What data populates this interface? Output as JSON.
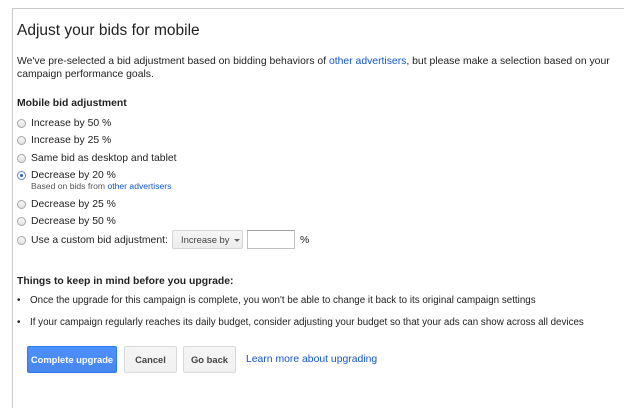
{
  "dialog": {
    "title": "Adjust your bids for mobile",
    "intro": {
      "before_link": "We've pre-selected a bid adjustment based on bidding behaviors of ",
      "link": "other advertisers",
      "after_link": ", but please make a selection based on your campaign performance goals."
    }
  },
  "bid_adjustment": {
    "heading": "Mobile bid adjustment",
    "selected_index": 3,
    "options": [
      {
        "label": "Increase by 50 %"
      },
      {
        "label": "Increase by 25 %"
      },
      {
        "label": "Same bid as desktop and tablet"
      },
      {
        "label": "Decrease by 20 %"
      },
      {
        "label": "Decrease by 25 %"
      },
      {
        "label": "Decrease by 50 %"
      },
      {
        "label": "Use a custom bid adjustment:"
      }
    ],
    "recommended_note": {
      "before_link": "Based on bids from ",
      "link": "other advertisers"
    },
    "custom": {
      "direction_selected": "Increase by",
      "value": "",
      "unit": "%"
    }
  },
  "upgrade_notes": {
    "heading": "Things to keep in mind before you upgrade:",
    "items": [
      "Once the upgrade for this campaign is complete, you won't be able to change it back to its original campaign settings",
      "If your campaign regularly reaches its daily budget, consider adjusting your budget so that your ads can show across all devices"
    ]
  },
  "actions": {
    "complete_label": "Complete upgrade",
    "cancel_label": "Cancel",
    "back_label": "Go back",
    "learn_more_label": "Learn more about upgrading"
  },
  "colors": {
    "link": "#1155cc",
    "primary_button": "#4d90fe",
    "border": "#c8c8c8"
  }
}
